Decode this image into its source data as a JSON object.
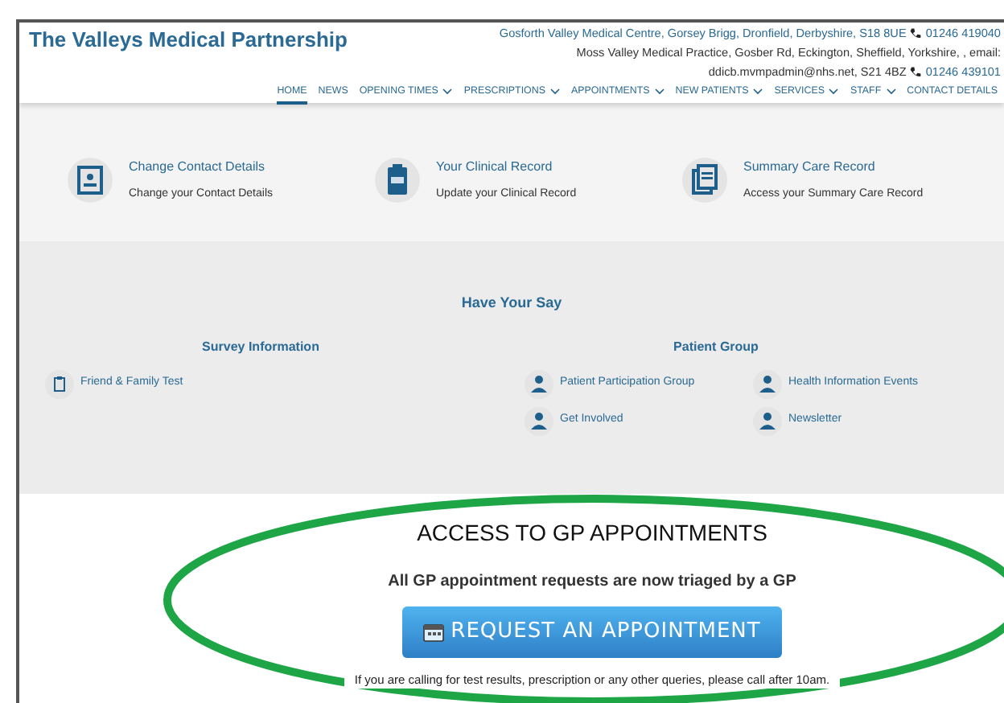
{
  "header": {
    "title": "The Valleys Medical Partnership",
    "contact_lines": [
      {
        "text": "Gosforth Valley Medical Centre, Gorsey Brigg, Dronfield, Derbyshire, S18 8UE",
        "phone": "01246 419040"
      },
      {
        "text": "Moss Valley Medical Practice, Gosber Rd, Eckington, Sheffield, Yorkshire, , email:"
      },
      {
        "text": "ddicb.mvmpadmin@nhs.net, S21 4BZ",
        "phone": "01246 439101"
      }
    ]
  },
  "nav": [
    {
      "label": "HOME",
      "selected": true,
      "dropdown": false
    },
    {
      "label": "NEWS",
      "selected": false,
      "dropdown": false
    },
    {
      "label": "OPENING TIMES",
      "selected": false,
      "dropdown": true
    },
    {
      "label": "PRESCRIPTIONS",
      "selected": false,
      "dropdown": true
    },
    {
      "label": "APPOINTMENTS",
      "selected": false,
      "dropdown": true
    },
    {
      "label": "NEW PATIENTS",
      "selected": false,
      "dropdown": true
    },
    {
      "label": "SERVICES",
      "selected": false,
      "dropdown": true
    },
    {
      "label": "STAFF",
      "selected": false,
      "dropdown": true
    },
    {
      "label": "CONTACT DETAILS",
      "selected": false,
      "dropdown": false
    }
  ],
  "cards": [
    {
      "kind": "contact",
      "title": "Change Contact Details",
      "subtitle": "Change your Contact Details"
    },
    {
      "kind": "clipboard",
      "title": "Your Clinical Record",
      "subtitle": "Update your Clinical Record"
    },
    {
      "kind": "document",
      "title": "Summary Care Record",
      "subtitle": "Access your Summary Care Record"
    }
  ],
  "have_your_say": {
    "title": "Have Your Say",
    "survey": {
      "heading": "Survey Information",
      "links": [
        "Friend & Family Test"
      ]
    },
    "patient_group": {
      "heading": "Patient Group",
      "links": [
        "Patient Participation Group",
        "Health Information Events",
        "Get Involved",
        "Newsletter"
      ]
    }
  },
  "access": {
    "heading": "ACCESS TO GP APPOINTMENTS",
    "subtitle": "All GP appointment requests are now triaged by a GP",
    "button": "REQUEST AN APPOINTMENT",
    "note": "If you are calling for test results, prescription or any other queries, please call after 10am."
  }
}
